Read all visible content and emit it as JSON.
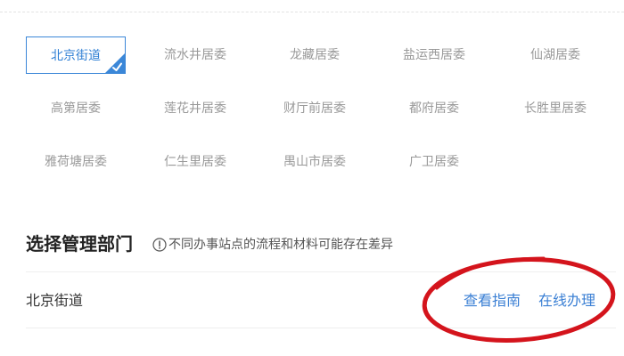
{
  "communities": [
    {
      "label": "北京街道",
      "selected": true
    },
    {
      "label": "流水井居委"
    },
    {
      "label": "龙藏居委"
    },
    {
      "label": "盐运西居委"
    },
    {
      "label": "仙湖居委"
    },
    {
      "label": "高第居委"
    },
    {
      "label": "莲花井居委"
    },
    {
      "label": "财厅前居委"
    },
    {
      "label": "都府居委"
    },
    {
      "label": "长胜里居委"
    },
    {
      "label": "雅荷塘居委"
    },
    {
      "label": "仁生里居委"
    },
    {
      "label": "禺山市居委"
    },
    {
      "label": "广卫居委"
    }
  ],
  "section": {
    "title": "选择管理部门",
    "hint": "不同办事站点的流程和材料可能存在差异",
    "info_icon": "info-circle-icon"
  },
  "department_row": {
    "name": "北京街道",
    "guide_link": "查看指南",
    "online_link": "在线办理"
  },
  "colors": {
    "accent": "#3b87d8",
    "annotation": "#d4141c"
  },
  "icons": {
    "selected_mark": "checkmark-icon"
  }
}
